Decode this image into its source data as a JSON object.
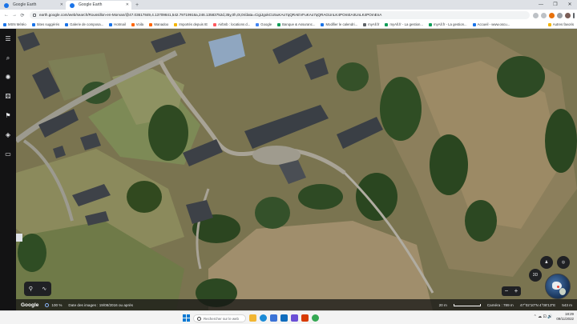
{
  "browser": {
    "tabs": [
      {
        "title": "Google Earth",
        "active": false
      },
      {
        "title": "Google Earth",
        "active": true
      }
    ],
    "new_tab": "+",
    "window_controls": [
      "—",
      "❐",
      "✕"
    ],
    "nav": {
      "back": "←",
      "forward": "→",
      "reload": "⟳"
    },
    "url": "earth.google.com/web/search/Roussillon-en-Morvan/@47.03617849,4.13709841,542.79719916a,246.13583752d,35y,0h,0t,0r/data=CigiJgokCU5uKAo7qQRAEVFuKAo7qQRAGUnLK4POmEAIIUnLK4POmEnA"
  },
  "bookmarks": [
    {
      "label": "MSN Météo",
      "color": "#1a73e8"
    },
    {
      "label": "Sites suggérés",
      "color": "#1a73e8"
    },
    {
      "label": "Galerie de composa...",
      "color": "#1a73e8"
    },
    {
      "label": "Hotmail",
      "color": "#1a73e8"
    },
    {
      "label": "Voila",
      "color": "#ff6600"
    },
    {
      "label": "Wanadoo",
      "color": "#ff6600"
    },
    {
      "label": "Importés depuis IE",
      "color": "#f4b400"
    },
    {
      "label": "Airbnb : locations d...",
      "color": "#ff5a5f"
    },
    {
      "label": "Google",
      "color": "#4285f4"
    },
    {
      "label": "Banque & Assuranc...",
      "color": "#0f9d58"
    },
    {
      "label": "Modifier le calendri...",
      "color": "#1a73e8"
    },
    {
      "label": "myAll.fr",
      "color": "#5f6368"
    },
    {
      "label": "myAll.fr - La gestion...",
      "color": "#0f9d58"
    },
    {
      "label": "myAll.fr - La gestion...",
      "color": "#0f9d58"
    },
    {
      "label": "Accueil - www.oscu...",
      "color": "#1a73e8"
    }
  ],
  "bookmarks_more": "Autres favoris",
  "earth": {
    "rail_icons": [
      {
        "name": "menu-icon",
        "glyph": "☰"
      },
      {
        "name": "search-icon",
        "glyph": "⌕"
      },
      {
        "name": "voyager-icon",
        "glyph": "✺"
      },
      {
        "name": "random-icon",
        "glyph": "⚄"
      },
      {
        "name": "projects-icon",
        "glyph": "⚑"
      },
      {
        "name": "layers-icon",
        "glyph": "◈"
      },
      {
        "name": "measure-icon",
        "glyph": "▭"
      }
    ],
    "logo": "Google",
    "zoom_percent": "100 %",
    "image_date": "Date des images : 19/08/2016 ou après",
    "scale_label": "20 m",
    "camera": "Caméra : 789 m",
    "coordinates": "47°02'10\"N 4°08'13\"E",
    "altitude": "543 m",
    "btn_3d": "3D",
    "zoom_minus": "−",
    "zoom_plus": "+",
    "person_glyph": "♟",
    "compass_glyph": "◎",
    "pin_glyph": "⚲",
    "path_glyph": "∿"
  },
  "taskbar": {
    "search_placeholder": "Rechercher sur le web",
    "apps": [
      {
        "name": "file-explorer-icon",
        "color": "#f2b632"
      },
      {
        "name": "edge-icon",
        "color": "#1b8bd6"
      },
      {
        "name": "store-icon",
        "color": "#3a72d6"
      },
      {
        "name": "mail-icon",
        "color": "#0f6cbd"
      },
      {
        "name": "photos-icon",
        "color": "#6b4fd6"
      },
      {
        "name": "office-icon",
        "color": "#d83b01"
      },
      {
        "name": "chrome-icon",
        "color": "#34a853"
      }
    ],
    "time": "18:29",
    "date": "09/11/2022",
    "tray": "⌃ ☁ ⊡ 🔊"
  }
}
